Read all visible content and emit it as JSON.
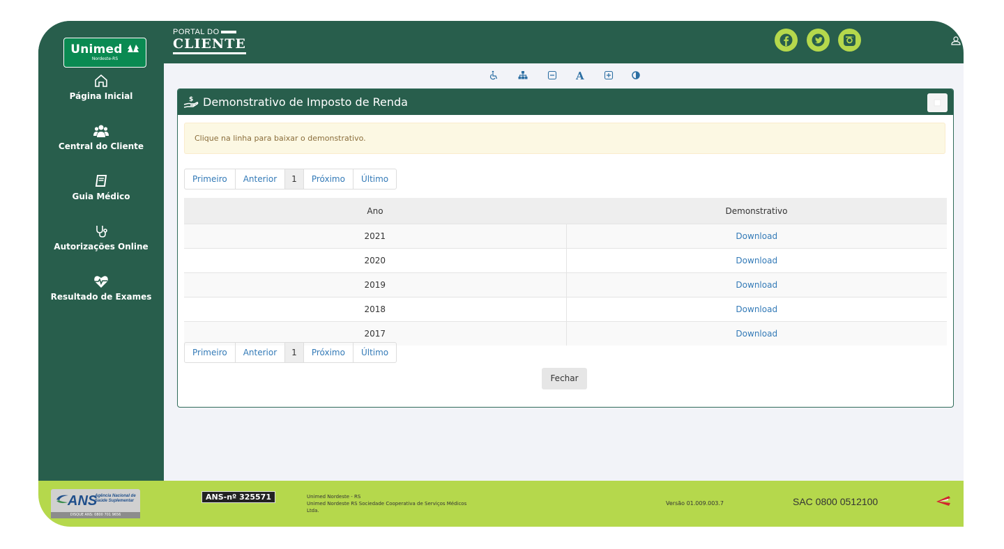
{
  "header": {
    "brand": "Unimed",
    "brand_sub": "Nordeste-RS",
    "portal_small": "PORTAL DO",
    "portal_big": "CLIENTE"
  },
  "colors": {
    "primary": "#285e4c",
    "accent": "#b5d84c",
    "logo_green": "#0a8a52",
    "link": "#337ab7"
  },
  "social": [
    "facebook-icon",
    "twitter-icon",
    "instagram-icon"
  ],
  "sidebar": {
    "items": [
      {
        "label": "Página Inicial",
        "icon": "home-icon"
      },
      {
        "label": "Central do Cliente",
        "icon": "users-icon"
      },
      {
        "label": "Guia Médico",
        "icon": "book-icon"
      },
      {
        "label": "Autorizações Online",
        "icon": "stethoscope-icon"
      },
      {
        "label": "Resultado de Exames",
        "icon": "heartbeat-icon"
      }
    ]
  },
  "accessibility_toolbar": {
    "items": [
      "wheelchair-icon",
      "sitemap-icon",
      "font-decrease-icon",
      "A",
      "font-increase-icon",
      "contrast-icon"
    ],
    "font_label": "A"
  },
  "panel": {
    "title": "Demonstrativo de Imposto de Renda",
    "alert": "Clique na linha para baixar o demonstrativo.",
    "pagination": {
      "first": "Primeiro",
      "prev": "Anterior",
      "current": "1",
      "next": "Próximo",
      "last": "Último"
    },
    "table": {
      "columns": [
        "Ano",
        "Demonstrativo"
      ],
      "rows": [
        {
          "year": "2021",
          "action": "Download"
        },
        {
          "year": "2020",
          "action": "Download"
        },
        {
          "year": "2019",
          "action": "Download"
        },
        {
          "year": "2018",
          "action": "Download"
        },
        {
          "year": "2017",
          "action": "Download"
        }
      ]
    },
    "close_label": "Fechar"
  },
  "footer": {
    "ans_logo_text": "ANS",
    "ans_logo_sub1": "Agência Nacional de",
    "ans_logo_sub2": "Saúde Suplementar",
    "ans_disque": "DISQUE ANS: 0800 701 9656",
    "ans_reg": "ANS-nº 325571",
    "line1": "Unimed Nordeste - RS",
    "line2": "Unimed Nordeste RS Sociedade Cooperativa de Serviços Médicos",
    "line3": "Ltda.",
    "version": "Versão 01.009.003.7",
    "sac": "SAC 0800 0512100"
  }
}
